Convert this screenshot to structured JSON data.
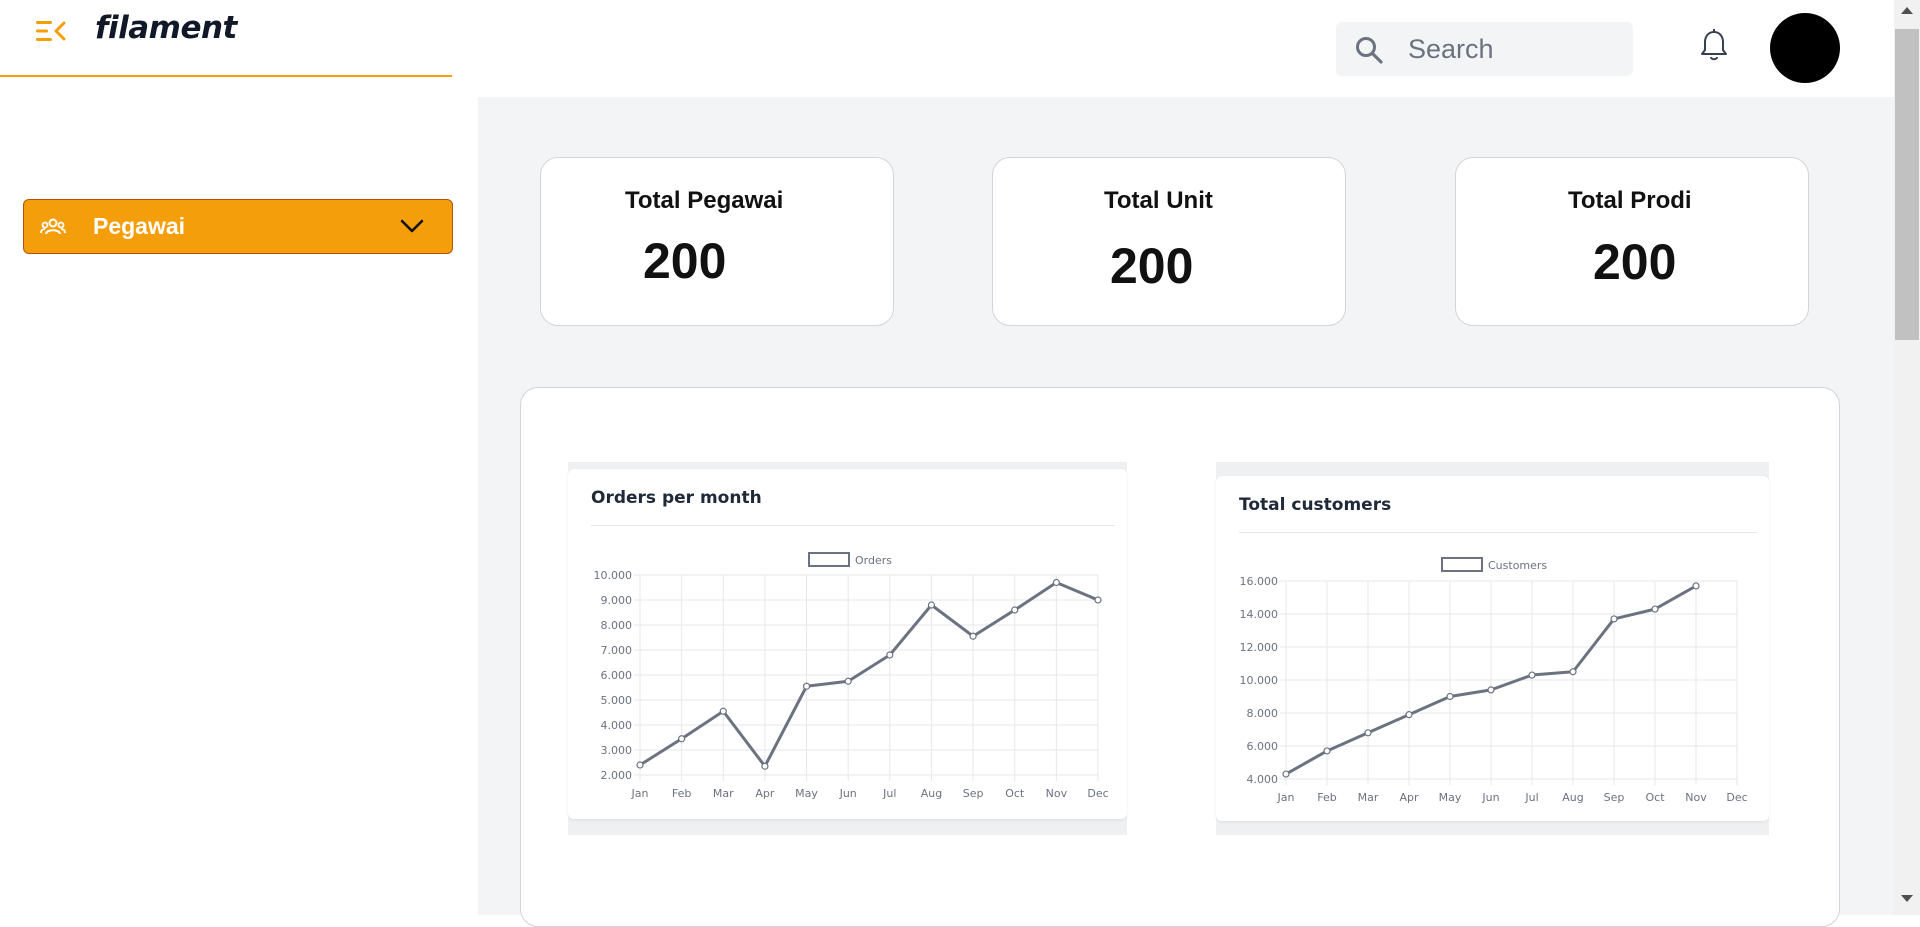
{
  "brand": {
    "name": "filament",
    "accent": "#f59e0b"
  },
  "header": {
    "search_placeholder": "Search"
  },
  "sidebar": {
    "items": [
      {
        "label": "Pegawai",
        "icon": "users-icon"
      }
    ]
  },
  "stats": [
    {
      "title": "Total Pegawai",
      "value": "200"
    },
    {
      "title": "Total Unit",
      "value": "200"
    },
    {
      "title": "Total Prodi",
      "value": "200"
    }
  ],
  "chart_data": [
    {
      "type": "line",
      "title": "Orders per month",
      "categories": [
        "Jan",
        "Feb",
        "Mar",
        "Apr",
        "May",
        "Jun",
        "Jul",
        "Aug",
        "Sep",
        "Oct",
        "Nov",
        "Dec"
      ],
      "series": [
        {
          "name": "Orders",
          "values": [
            2400,
            3450,
            4550,
            2350,
            5550,
            5750,
            6800,
            8800,
            7550,
            8600,
            9700,
            9000
          ]
        }
      ],
      "ylim": [
        2000,
        10000
      ],
      "yticks": [
        "2.000",
        "3.000",
        "4.000",
        "5.000",
        "6.000",
        "7.000",
        "8.000",
        "9.000",
        "10.000"
      ],
      "grid": true,
      "legend": "top"
    },
    {
      "type": "line",
      "title": "Total customers",
      "categories": [
        "Jan",
        "Feb",
        "Mar",
        "Apr",
        "May",
        "Jun",
        "Jul",
        "Aug",
        "Sep",
        "Oct",
        "Nov",
        "Dec"
      ],
      "series": [
        {
          "name": "Customers",
          "values": [
            4300,
            5700,
            6800,
            7900,
            9000,
            9400,
            10300,
            10500,
            13700,
            14300,
            15700
          ]
        }
      ],
      "ylim": [
        4000,
        16000
      ],
      "yticks": [
        "4.000",
        "6.000",
        "8.000",
        "10.000",
        "12.000",
        "14.000",
        "16.000"
      ],
      "grid": true,
      "legend": "top"
    }
  ]
}
